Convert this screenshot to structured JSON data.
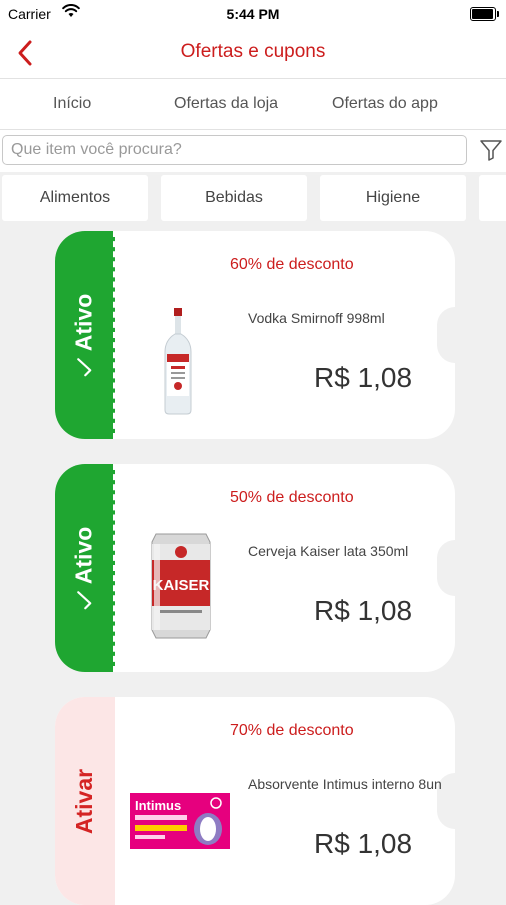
{
  "status_bar": {
    "carrier": "Carrier",
    "time": "5:44 PM"
  },
  "header": {
    "title": "Ofertas e cupons"
  },
  "tabs": [
    {
      "label": "Início"
    },
    {
      "label": "Ofertas da loja"
    },
    {
      "label": "Ofertas do app"
    }
  ],
  "search": {
    "placeholder": "Que item você procura?"
  },
  "categories": [
    {
      "label": "Alimentos"
    },
    {
      "label": "Bebidas"
    },
    {
      "label": "Higiene"
    }
  ],
  "offers": [
    {
      "status": "Ativo",
      "discount": "60% de desconto",
      "product": "Vodka Smirnoff 998ml",
      "price": "R$ 1,08"
    },
    {
      "status": "Ativo",
      "discount": "50% de desconto",
      "product": "Cerveja Kaiser lata 350ml",
      "price": "R$ 1,08"
    },
    {
      "status": "Ativar",
      "discount": "70% de desconto",
      "product": "Absorvente Intimus interno 8un",
      "price": "R$ 1,08"
    }
  ],
  "product_labels": {
    "kaiser": "KAISER",
    "intimus": "Intimus"
  },
  "colors": {
    "brand_red": "#cc1d1d",
    "active_green": "#1fa631",
    "inactive_pink": "#fce6e6",
    "background": "#f0f0f0"
  },
  "icons": {
    "back": "chevron-left-icon",
    "filter": "funnel-icon",
    "wifi": "wifi-icon",
    "battery": "battery-icon",
    "check": "check-icon"
  }
}
